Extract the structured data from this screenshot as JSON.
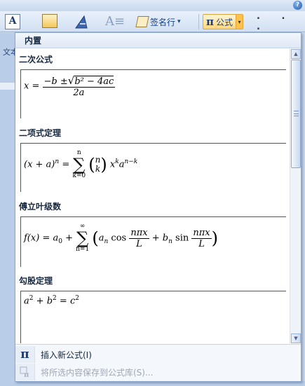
{
  "ribbon": {
    "textbox_label": "文本框",
    "textbox_icon_letter": "A",
    "signature_label": "签名行",
    "signature_dropdown": "▾",
    "equation_label": "公式",
    "equation_icon": "π",
    "equation_dropdown": "▾",
    "symbol_dots": ". . .",
    "help": "?"
  },
  "gallery": {
    "header": "内置",
    "entries": [
      {
        "title": "二次公式"
      },
      {
        "title": "二项式定理"
      },
      {
        "title": "傅立叶级数"
      },
      {
        "title": "勾股定理"
      }
    ],
    "formulas": {
      "quadratic": {
        "lhs": "x =",
        "numerator_start": "−b ±",
        "radicand": "b² − 4ac",
        "denominator": "2a"
      },
      "binomial": {
        "lhs": "(x + a)",
        "lhs_exp": "n",
        "eq": "=",
        "sum_top": "n",
        "sum_bottom": "k=0",
        "binom_top": "n",
        "binom_bottom": "k",
        "term": "x",
        "term_exp": "k",
        "term2": "a",
        "term2_exp": "n−k"
      },
      "fourier": {
        "lhs": "f(x) = a",
        "a0_sub": "0",
        "plus": "+",
        "sum_top": "∞",
        "sum_bottom": "n=1",
        "an": "a",
        "an_sub": "n",
        "cos": "cos",
        "frac_num": "nπx",
        "frac_den": "L",
        "plus2": "+",
        "bn": "b",
        "bn_sub": "n",
        "sin": "sin"
      },
      "pythagorean": {
        "a": "a",
        "a_exp": "2",
        "plus": "+",
        "b": "b",
        "b_exp": "2",
        "eq": "=",
        "c": "c",
        "c_exp": "2"
      }
    },
    "footer": {
      "insert_new_icon": "π",
      "insert_new": "插入新公式(I)",
      "save_selection": "将所选内容保存到公式库(S)..."
    }
  }
}
